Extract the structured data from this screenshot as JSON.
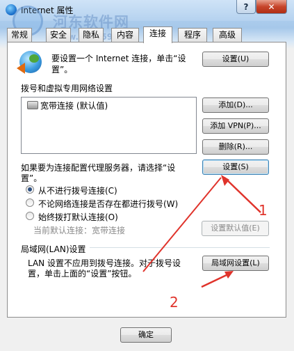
{
  "window": {
    "title": "Internet 属性",
    "help_label": "?",
    "close_label": "✕"
  },
  "watermark": {
    "text": "河东软件网",
    "url": "www.pc0359.cn"
  },
  "tabs": [
    {
      "label": "常规",
      "active": false
    },
    {
      "label": "安全",
      "active": false
    },
    {
      "label": "隐私",
      "active": false
    },
    {
      "label": "内容",
      "active": false
    },
    {
      "label": "连接",
      "active": true
    },
    {
      "label": "程序",
      "active": false
    },
    {
      "label": "高级",
      "active": false
    }
  ],
  "setup": {
    "line1": "要设置一个 Internet 连接，单击“设",
    "line2": "置”。",
    "button": "设置(U)"
  },
  "dialup": {
    "heading": "拨号和虚拟专用网络设置",
    "items": [
      {
        "label": "宽带连接 (默认值)"
      }
    ],
    "add_button": "添加(D)...",
    "add_vpn_button": "添加 VPN(P)...",
    "remove_button": "删除(R)...",
    "proxy_text_line1": "如果要为连接配置代理服务器，请选择“设",
    "proxy_text_line2": "置”。",
    "settings_button": "设置(S)",
    "options": [
      {
        "label": "从不进行拨号连接(C)",
        "selected": true
      },
      {
        "label": "不论网络连接是否存在都进行拨号(W)",
        "selected": false
      },
      {
        "label": "始终拨打默认连接(O)",
        "selected": false
      }
    ],
    "current_default_label": "当前默认连接：",
    "current_default_value": "宽带连接",
    "set_default_button": "设置默认值(E)"
  },
  "lan": {
    "heading": "局域网(LAN)设置",
    "text_line1": "LAN 设置不应用到拨号连接。对于拨号设",
    "text_line2": "置，单击上面的“设置”按钮。",
    "button": "局域网设置(L)"
  },
  "footer": {
    "ok_button": "确定"
  },
  "annotations": {
    "label_1": "1",
    "label_2": "2",
    "color": "#e0332b"
  }
}
